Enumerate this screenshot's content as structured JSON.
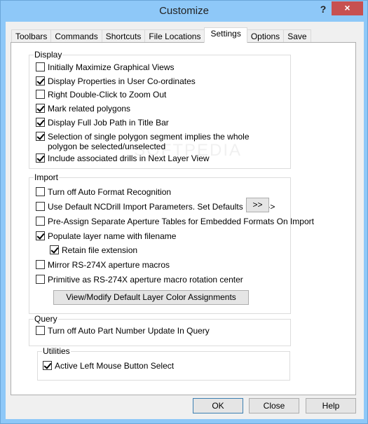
{
  "window": {
    "title": "Customize",
    "help_label": "?",
    "close_label": "×"
  },
  "tabs": [
    {
      "label": "Toolbars",
      "active": false
    },
    {
      "label": "Commands",
      "active": false
    },
    {
      "label": "Shortcuts",
      "active": false
    },
    {
      "label": "File Locations",
      "active": false
    },
    {
      "label": "Settings",
      "active": true
    },
    {
      "label": "Options",
      "active": false
    },
    {
      "label": "Save",
      "active": false
    }
  ],
  "display": {
    "label": "Display",
    "items": [
      {
        "label": "Initially Maximize Graphical Views",
        "checked": false
      },
      {
        "label": "Display Properties in User Co-ordinates",
        "checked": true
      },
      {
        "label": "Right Double-Click to Zoom Out",
        "checked": false
      },
      {
        "label": "Mark related polygons",
        "checked": true
      },
      {
        "label": "Display Full Job Path in Title Bar",
        "checked": true
      },
      {
        "label": "Selection of single polygon segment implies the whole polygon be selected/unselected",
        "checked": true
      },
      {
        "label": "Include associated drills in Next Layer View",
        "checked": true
      }
    ]
  },
  "import": {
    "label": "Import",
    "items": [
      {
        "label": "Turn off Auto Format Recognition",
        "checked": false
      },
      {
        "label": "Use Default NCDrill Import Parameters. Set Defaults here -->",
        "checked": false
      },
      {
        "label": "Pre-Assign Separate Aperture Tables for Embedded Formats On Import",
        "checked": false
      },
      {
        "label": "Populate layer name with filename",
        "checked": true
      },
      {
        "label": "Retain file extension",
        "checked": true
      },
      {
        "label": "Mirror RS-274X aperture macros",
        "checked": false
      },
      {
        "label": "Primitive as RS-274X aperture macro rotation center",
        "checked": false
      }
    ],
    "defaults_button": ">>",
    "color_button": "View/Modify Default Layer Color Assignments"
  },
  "query": {
    "label": "Query",
    "items": [
      {
        "label": "Turn off Auto Part Number Update In Query",
        "checked": false
      }
    ]
  },
  "utilities": {
    "label": "Utilities",
    "items": [
      {
        "label": "Active Left Mouse Button Select",
        "checked": true
      }
    ]
  },
  "footer": {
    "ok": "OK",
    "close": "Close",
    "help": "Help"
  },
  "watermark": "SOFTPEDIA"
}
